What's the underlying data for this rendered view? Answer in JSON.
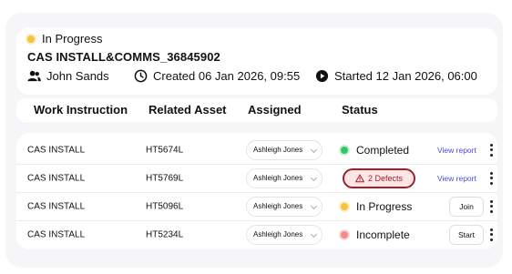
{
  "job": {
    "status": "In Progress",
    "title": "CAS INSTALL&COMMS_36845902",
    "assignee": "John Sands",
    "created": "Created 06 Jan 2026, 09:55",
    "started": "Started 12 Jan 2026, 06:00"
  },
  "columns": {
    "work_instruction": "Work Instruction",
    "related_asset": "Related Asset",
    "assigned": "Assigned",
    "status": "Status"
  },
  "rows": [
    {
      "work_instruction": "CAS INSTALL",
      "asset": "HT5674L",
      "assigned": "Ashleigh Jones",
      "status": "Completed",
      "action": "View report"
    },
    {
      "work_instruction": "CAS INSTALL",
      "asset": "HT5769L",
      "assigned": "Ashleigh Jones",
      "status": "2 Defects",
      "action": "View report"
    },
    {
      "work_instruction": "CAS INSTALL",
      "asset": "HT5096L",
      "assigned": "Ashleigh Jones",
      "status": "In Progress",
      "action": "Join"
    },
    {
      "work_instruction": "CAS INSTALL",
      "asset": "HT5234L",
      "assigned": "Ashleigh Jones",
      "status": "Incomplete",
      "action": "Start"
    }
  ],
  "colors": {
    "in_progress": "#f6c13b",
    "completed": "#2fc76a",
    "incomplete": "#f28b8b",
    "defect": "#a31f2c",
    "link": "#4a4ad9"
  },
  "icons": {
    "user": "users-icon",
    "created": "clock-icon",
    "started": "play-circle-icon",
    "defect": "warning-triangle-icon",
    "menu": "kebab-menu-icon"
  }
}
